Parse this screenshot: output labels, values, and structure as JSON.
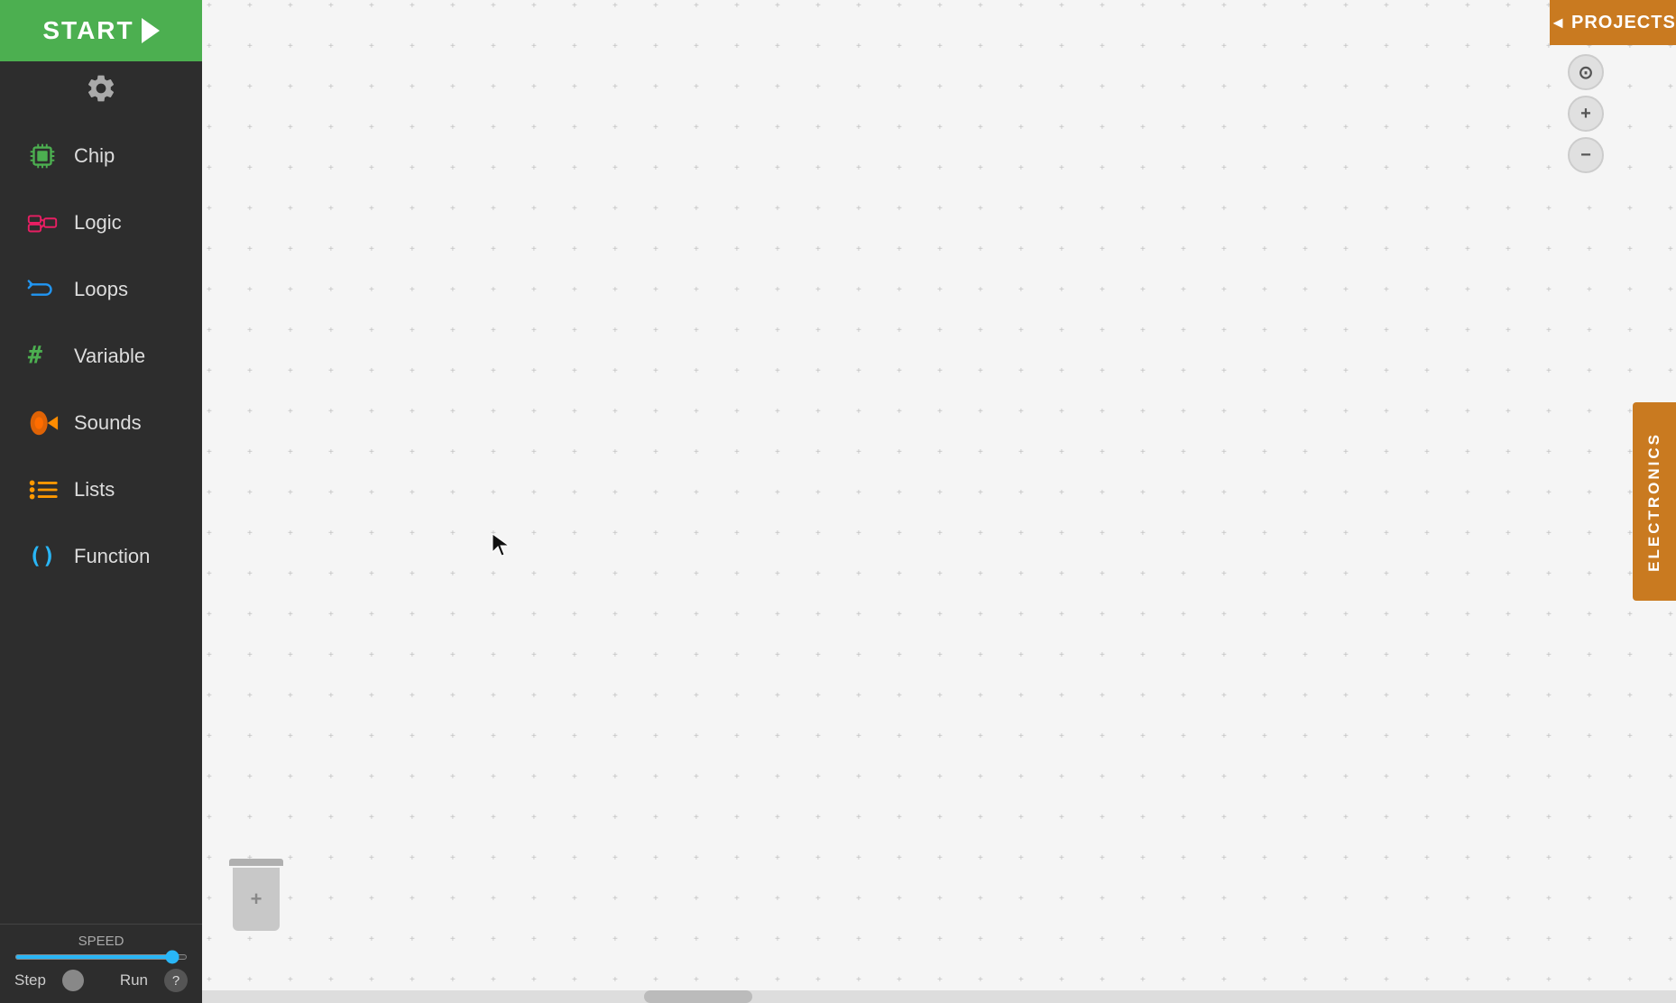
{
  "start": {
    "label": "START",
    "play_symbol": "▶"
  },
  "settings": {
    "tooltip": "Settings"
  },
  "nav": {
    "items": [
      {
        "id": "chip",
        "label": "Chip",
        "color": "#4caf50"
      },
      {
        "id": "logic",
        "label": "Logic",
        "color": "#e91e63"
      },
      {
        "id": "loops",
        "label": "Loops",
        "color": "#2196f3"
      },
      {
        "id": "variable",
        "label": "Variable",
        "color": "#4caf50"
      },
      {
        "id": "sounds",
        "label": "Sounds",
        "color": "#ff6d00"
      },
      {
        "id": "lists",
        "label": "Lists",
        "color": "#ff9800"
      },
      {
        "id": "function",
        "label": "Function",
        "color": "#29b6f6"
      }
    ]
  },
  "bottom": {
    "speed_label": "SPEED",
    "step_label": "Step",
    "run_label": "Run",
    "help_label": "?"
  },
  "toolbar": {
    "projects_label": "PROJECTS"
  },
  "electronics": {
    "label": "ELECTRONICS"
  },
  "zoom": {
    "target_icon": "⊙",
    "plus_icon": "+",
    "minus_icon": "−"
  }
}
